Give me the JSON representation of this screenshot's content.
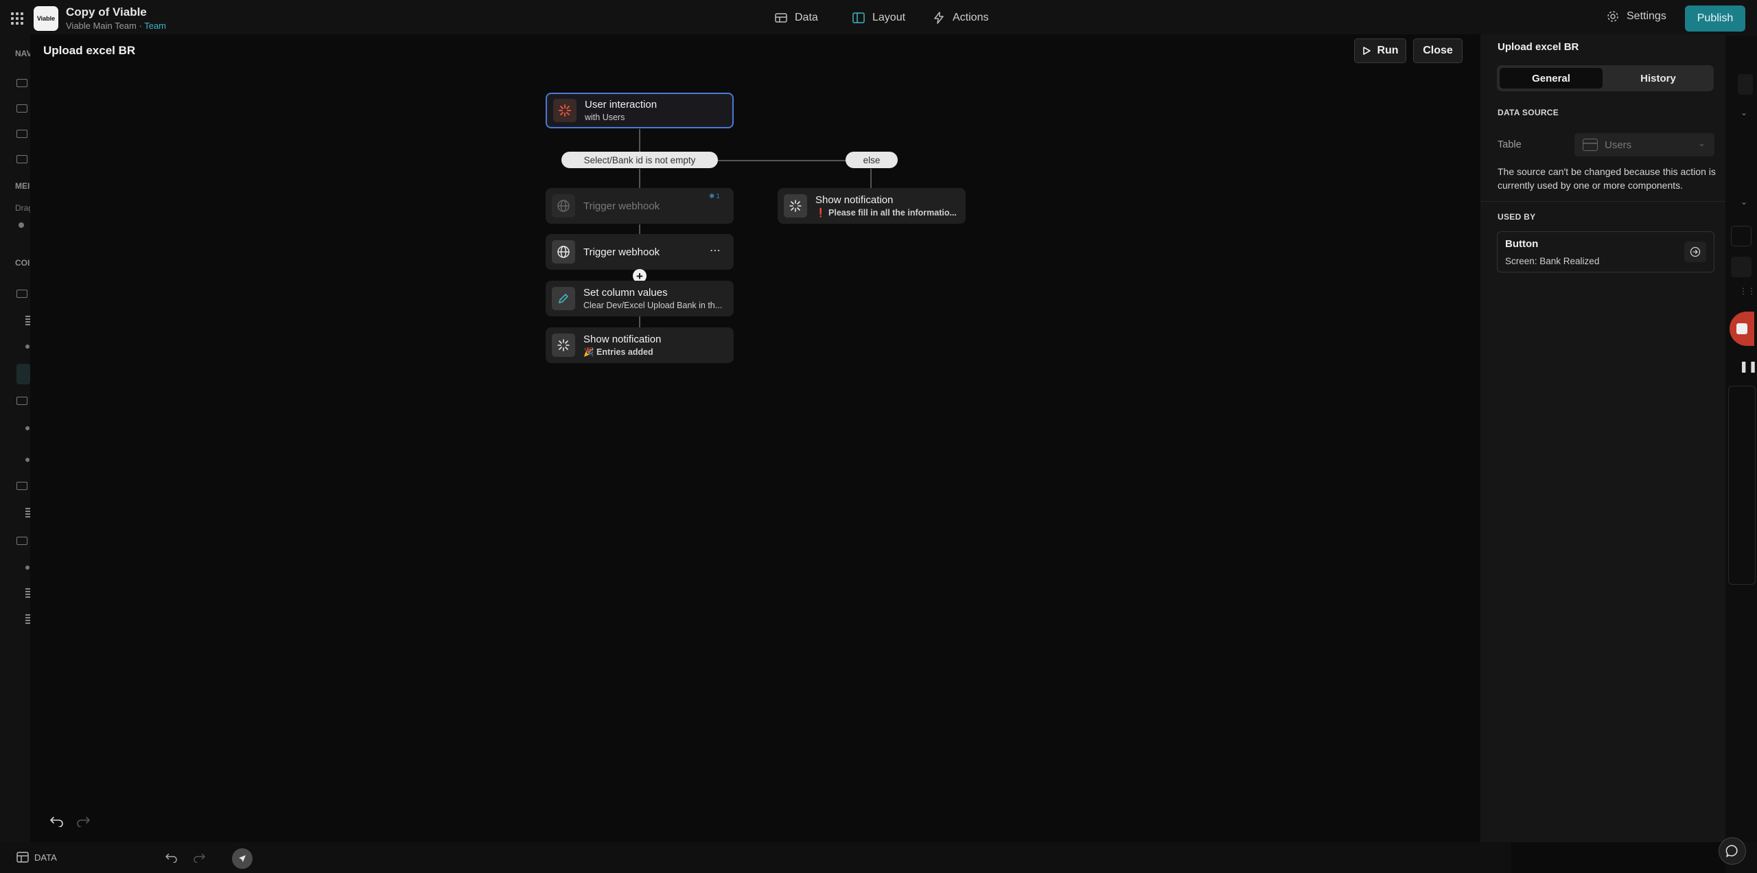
{
  "app": {
    "logo_text": "Viable",
    "title": "Copy of Viable",
    "team_name": "Viable Main Team",
    "separator": "·",
    "team_label": "Team"
  },
  "nav": {
    "data_label": "Data",
    "layout_label": "Layout",
    "actions_label": "Actions",
    "settings_label": "Settings",
    "publish_label": "Publish"
  },
  "leftbar": {
    "nav_head": "NAV",
    "menu_head": "MEI",
    "menu_sub": "Drag",
    "comp_head": "COI"
  },
  "canvas": {
    "title": "Upload excel BR",
    "run_label": "Run",
    "close_label": "Close"
  },
  "flow": {
    "trigger_title": "User interaction",
    "trigger_sub": "with Users",
    "condition_label": "Select/Bank id is not empty",
    "else_label": "else",
    "webhook_disabled_title": "Trigger webhook",
    "webhook_disabled_badge": "1",
    "webhook_title": "Trigger webhook",
    "set_values_title": "Set column values",
    "set_values_sub": "Clear Dev/Excel Upload Bank in th...",
    "notify_title": "Show notification",
    "notify_sub": "🎉 Entries added",
    "else_notify_title": "Show notification",
    "else_notify_sub": "❗ Please fill in all the informatio..."
  },
  "panel": {
    "title": "Upload excel BR",
    "tab_general": "General",
    "tab_history": "History",
    "data_source_head": "DATA SOURCE",
    "table_label": "Table",
    "table_value": "Users",
    "note": "The source can't be changed because this action is currently used by one or more components.",
    "used_by_head": "USED BY",
    "used_by_title": "Button",
    "used_by_sub": "Screen: Bank Realized"
  },
  "bottom": {
    "data_label": "DATA"
  },
  "colors": {
    "accent": "#1b7f89",
    "selection": "#4c79d8",
    "link": "#3fb4c2"
  }
}
